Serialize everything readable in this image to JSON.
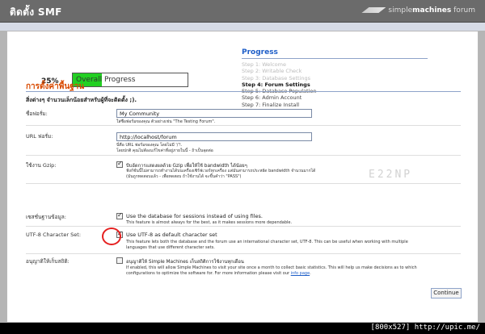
{
  "header": {
    "title": "ติดตั้ง SMF",
    "brand_prefix": "simple",
    "brand_main": "machines",
    "brand_suffix": " forum"
  },
  "progress_bar": {
    "percent_text": "25%",
    "label": "Overall Progress",
    "fraction": 0.25,
    "fill_color": "#23d023"
  },
  "steps": {
    "title": "Progress",
    "items": [
      {
        "label": "Step 1: Welcome",
        "state": "done"
      },
      {
        "label": "Step 2: Writable Check",
        "state": "done"
      },
      {
        "label": "Step 3: Database Settings",
        "state": "done"
      },
      {
        "label": "Step 4: Forum Settings",
        "state": "current"
      },
      {
        "label": "Step 5: Database Population",
        "state": "future"
      },
      {
        "label": "Step 6: Admin Account",
        "state": "future"
      },
      {
        "label": "Step 7: Finalize Install",
        "state": "future"
      }
    ]
  },
  "section": {
    "title": "การตั้งค่าพื้นฐาน",
    "intro": "สิ่งต่างๆ จำนวนเล็กน้อยสำหรับผู้ที่จะติดตั้ง ;)."
  },
  "forum_name": {
    "label": "ชื่อฟอรั่ม:",
    "value": "My Community",
    "hint": "ใส่ชื่อฟอรั่มของคุณ ตัวอย่างเช่น \"The Testing Forum\"."
  },
  "forum_url": {
    "label": "URL ฟอรั่ม:",
    "value": "http://localhost/forum",
    "hint1": "นี่คือ URL ฟอรั่มของคุณ โดยไม่มี '/'!.",
    "hint2": "โดยปกติ คุณไม่ต้องแก้ไขค่าที่อยู่ภายในนี้ - ถ้าเป็นจุดต่อ"
  },
  "gzip": {
    "label": "ใช้งาน Gzip:",
    "option": "บีบอัดการแสดงผลด้วย Gzip เพื่อให้ใช้ bandwidth ได้น้อยๆ",
    "desc1": "ฟังก์ชั่นนี้ไม่สามารถทำงานได้บนเครื่องเซิร์ฟเวอร์ทุกเครื่อง แต่มันสามารถประหยัด bandwidth จำนวนมากได้",
    "desc2": "(มันถูกทดสอบแล้ว - เพื่อทดสอบ ถ้าใช้งานได้ จะขึ้นคำว่า \"PASS\")"
  },
  "sessions": {
    "label": "เซสชั่นฐานข้อมูล:",
    "option": "Use the database for sessions instead of using files.",
    "desc": "This feature is almost always for the best, as it makes sessions more dependable."
  },
  "utf8": {
    "label": "UTF-8 Character Set:",
    "option": "Use UTF-8 as default character set",
    "desc1": "This feature lets both the database and the forum use an international character set, UTF-8. This can be useful when working with multiple",
    "desc2": "languages that use different character sets."
  },
  "stats": {
    "label": "อนุญาติให้เก็บสถิติ:",
    "option": "อนุญาติให้ Simple Machines เก็บสถิติการใช้งานทุกเดือน",
    "desc1": "If enabled, this will allow Simple Machines to visit your site once a month to collect basic statistics. This will help us make decisions as to which",
    "desc2_prefix": "configurations to optimize the software for. For more information please visit our ",
    "desc2_link": "info page",
    "desc2_suffix": "."
  },
  "watermark": "E22NP",
  "continue_label": "Continue",
  "footer_caption": "[800x527] http://upic.me/",
  "colors": {
    "accent_blue": "#1e5ec8",
    "section_orange": "#d94a00",
    "annotation_red": "#e52020"
  }
}
